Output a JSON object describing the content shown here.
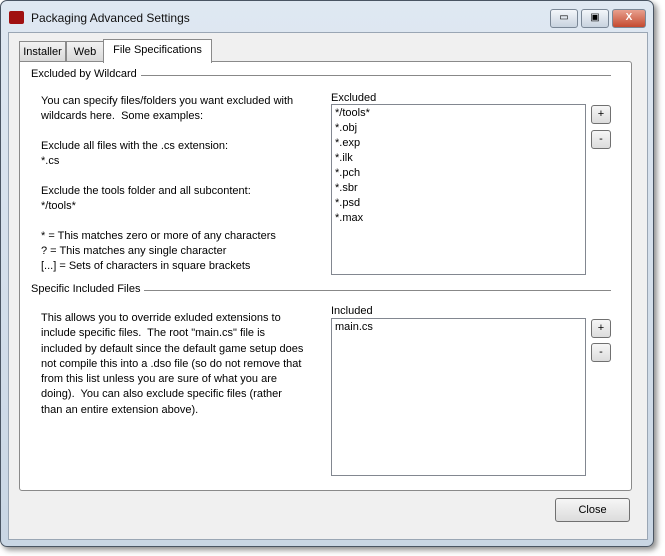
{
  "window": {
    "title": "Packaging Advanced Settings",
    "minimize": "▭",
    "maximize": "▣",
    "close": "X"
  },
  "tabs": [
    {
      "label": "Installer"
    },
    {
      "label": "Web"
    },
    {
      "label": "File Specifications",
      "active": true
    }
  ],
  "excluded": {
    "section": "Excluded by Wildcard",
    "description": "You can specify files/folders you want excluded with\nwildcards here.  Some examples:\n\nExclude all files with the .cs extension:\n*.cs\n\nExclude the tools folder and all subcontent:\n*/tools*\n\n* = This matches zero or more of any characters\n? = This matches any single character\n[...] = Sets of characters in square brackets",
    "list_label": "Excluded",
    "items": [
      "*/tools*",
      "*.obj",
      "*.exp",
      "*.ilk",
      "*.pch",
      "*.sbr",
      "*.psd",
      "*.max"
    ],
    "add": "+",
    "remove": "-"
  },
  "included": {
    "section": "Specific Included Files",
    "description": "This allows you to override exluded extensions to\ninclude specific files.  The root \"main.cs\" file is\nincluded by default since the default game setup does\nnot compile this into a .dso file (so do not remove that\nfrom this list unless you are sure of what you are\ndoing).  You can also exclude specific files (rather\nthan an entire extension above).",
    "list_label": "Included",
    "items": [
      "main.cs"
    ],
    "add": "+",
    "remove": "-"
  },
  "close_label": "Close"
}
